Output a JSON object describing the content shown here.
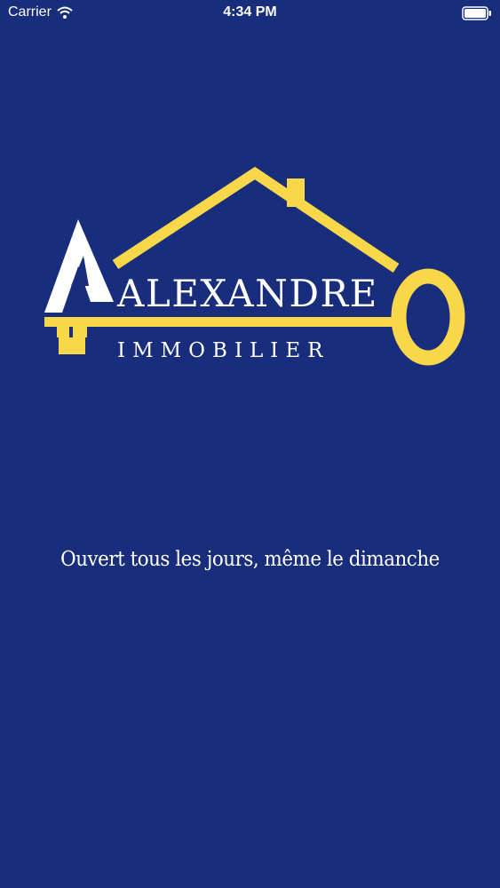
{
  "status_bar": {
    "carrier": "Carrier",
    "time": "4:34 PM",
    "wifi_icon": "wifi-icon",
    "battery_icon": "battery-icon"
  },
  "logo": {
    "name": "ALEXANDRE",
    "subtitle": "IMMOBILIER",
    "icon": "house-key-logo",
    "colors": {
      "accent": "#f8d74a",
      "text": "#ffffff",
      "background": "#182d7b"
    }
  },
  "tagline": "Ouvert tous les jours, même le dimanche"
}
